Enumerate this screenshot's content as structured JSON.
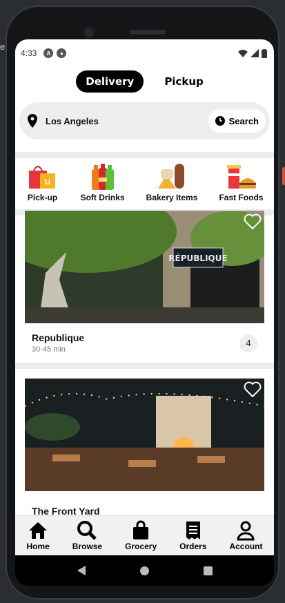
{
  "status": {
    "time": "4:33"
  },
  "tabs": {
    "delivery": "Delivery",
    "pickup": "Pickup"
  },
  "search": {
    "location": "Los Angeles",
    "button": "Search"
  },
  "categories": [
    {
      "label": "Pick-up",
      "icon": "shopping-bag-icon"
    },
    {
      "label": "Soft Drinks",
      "icon": "soda-bottles-icon"
    },
    {
      "label": "Bakery Items",
      "icon": "bread-icon"
    },
    {
      "label": "Fast Foods",
      "icon": "burger-icon"
    }
  ],
  "restaurants": [
    {
      "name": "Republique",
      "time": "30-45 min",
      "badge": "4",
      "sign": "RÉPUBLIQUE"
    },
    {
      "name": "The Front Yard",
      "time": "",
      "badge": ""
    }
  ],
  "nav": {
    "home": "Home",
    "browse": "Browse",
    "grocery": "Grocery",
    "orders": "Orders",
    "account": "Account"
  },
  "colors": {
    "accent": "#000000",
    "background": "#ffffff",
    "divider": "#ececec"
  }
}
